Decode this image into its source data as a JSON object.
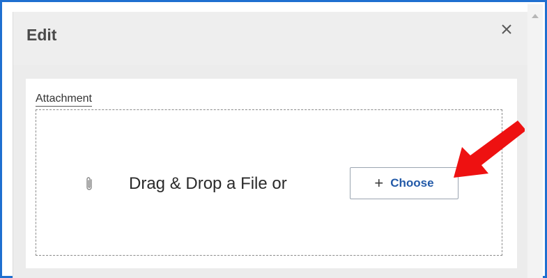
{
  "dialog": {
    "title": "Edit",
    "close_icon": "close-icon"
  },
  "attachment": {
    "label": "Attachment",
    "dropzone_text": "Drag & Drop a File or",
    "clip_icon": "paperclip-icon",
    "choose_button": {
      "icon": "plus",
      "icon_glyph": "+",
      "label": "Choose"
    }
  },
  "colors": {
    "frame_border": "#1f6fd0",
    "button_text": "#235aa8",
    "annotation_arrow": "#ee1111"
  }
}
